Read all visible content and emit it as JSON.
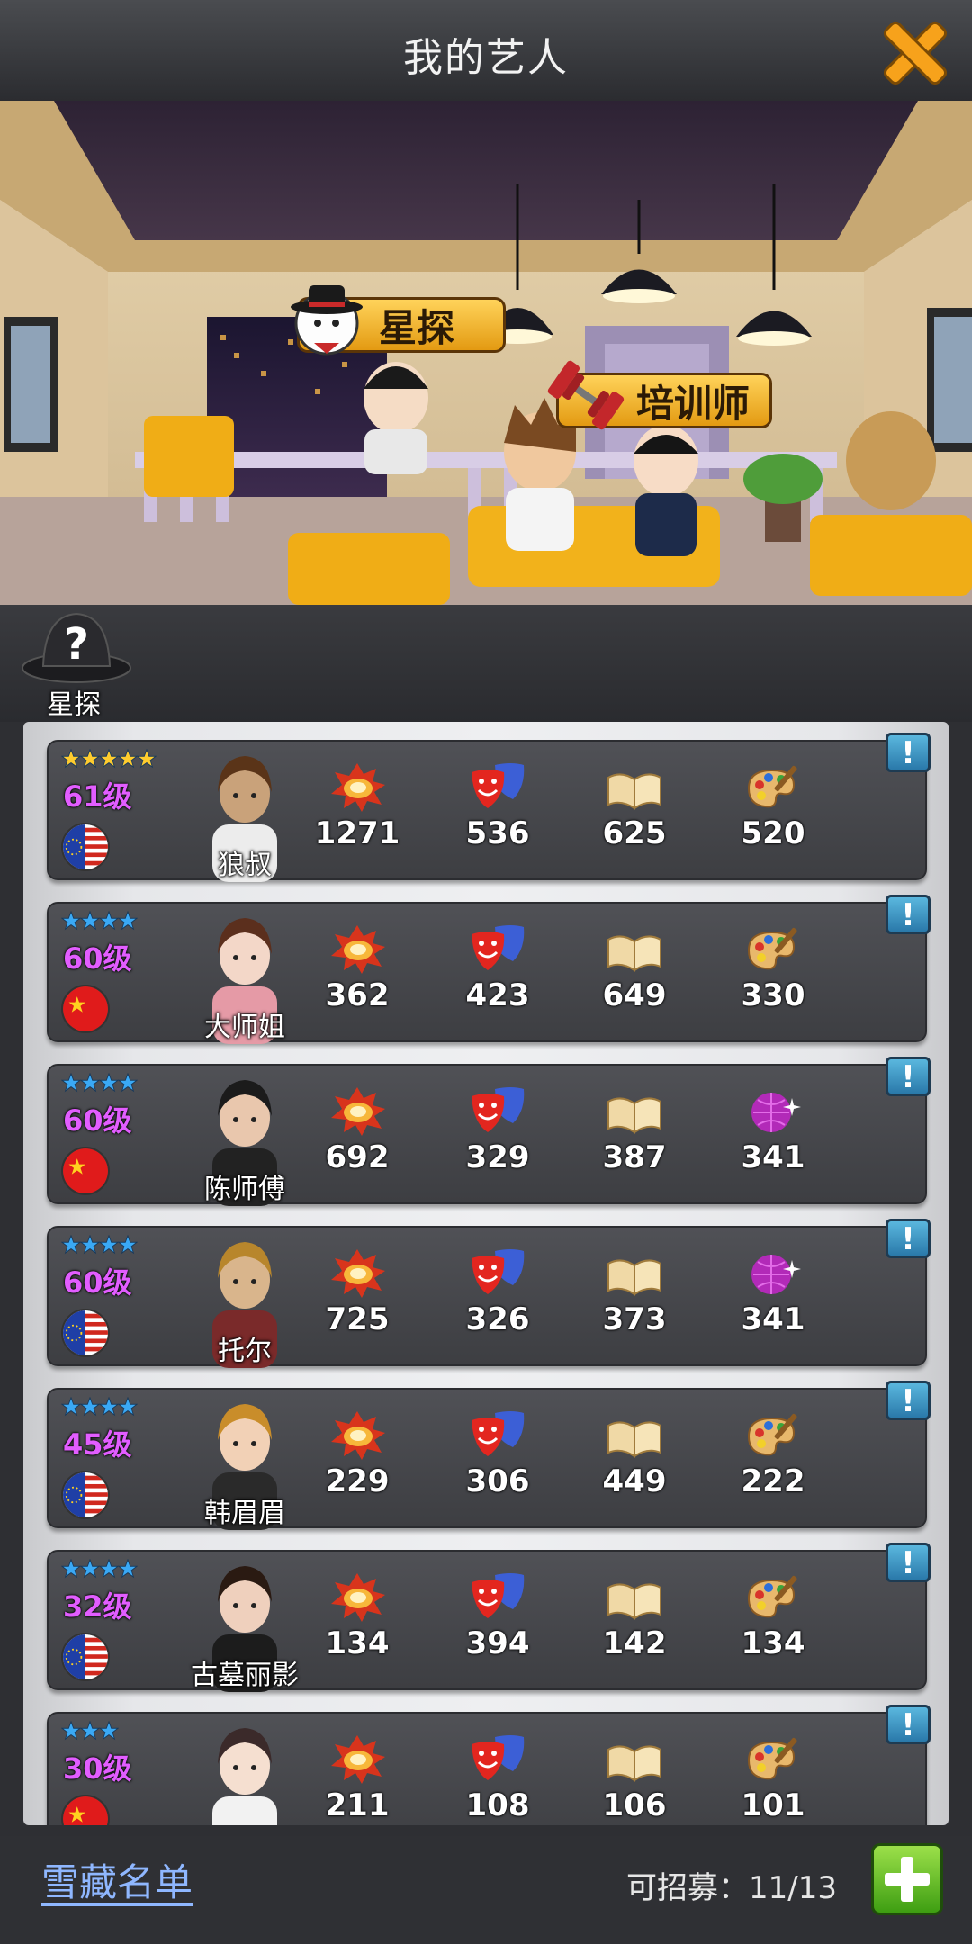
{
  "header": {
    "title": "我的艺人"
  },
  "scene": {
    "scout_tag": "星探",
    "trainer_tag": "培训师"
  },
  "scout_bar": {
    "label": "星探"
  },
  "artists": [
    {
      "stars": 5,
      "star_color": "gold",
      "level": "61级",
      "flag": "eu-us",
      "name": "狼叔",
      "stat_icons": [
        "explosion",
        "drama-mask",
        "book",
        "palette"
      ],
      "stats": [
        "1271",
        "536",
        "625",
        "520"
      ]
    },
    {
      "stars": 4,
      "star_color": "blue",
      "level": "60级",
      "flag": "china",
      "name": "大师姐",
      "stat_icons": [
        "explosion",
        "drama-mask",
        "book",
        "palette"
      ],
      "stats": [
        "362",
        "423",
        "649",
        "330"
      ]
    },
    {
      "stars": 4,
      "star_color": "blue",
      "level": "60级",
      "flag": "china",
      "name": "陈师傅",
      "stat_icons": [
        "explosion",
        "drama-mask",
        "book",
        "disco-ball"
      ],
      "stats": [
        "692",
        "329",
        "387",
        "341"
      ]
    },
    {
      "stars": 4,
      "star_color": "blue",
      "level": "60级",
      "flag": "eu-us",
      "name": "托尔",
      "stat_icons": [
        "explosion",
        "drama-mask",
        "book",
        "disco-ball"
      ],
      "stats": [
        "725",
        "326",
        "373",
        "341"
      ]
    },
    {
      "stars": 4,
      "star_color": "blue",
      "level": "45级",
      "flag": "eu-us",
      "name": "韩眉眉",
      "stat_icons": [
        "explosion",
        "drama-mask",
        "book",
        "palette"
      ],
      "stats": [
        "229",
        "306",
        "449",
        "222"
      ]
    },
    {
      "stars": 4,
      "star_color": "blue",
      "level": "32级",
      "flag": "eu-us",
      "name": "古墓丽影",
      "stat_icons": [
        "explosion",
        "drama-mask",
        "book",
        "palette"
      ],
      "stats": [
        "134",
        "394",
        "142",
        "134"
      ]
    },
    {
      "stars": 3,
      "star_color": "blue",
      "level": "30级",
      "flag": "china",
      "name": "",
      "stat_icons": [
        "explosion",
        "drama-mask",
        "book",
        "palette"
      ],
      "stats": [
        "211",
        "108",
        "106",
        "101"
      ]
    }
  ],
  "footer": {
    "freeze_list": "雪藏名单",
    "recruit_text": "可招募：11/13"
  },
  "colors": {
    "accent_orange": "#f5a623",
    "level_purple": "#e25dff",
    "star_blue": "#3aa9f5",
    "star_gold": "#ffcc2e"
  }
}
